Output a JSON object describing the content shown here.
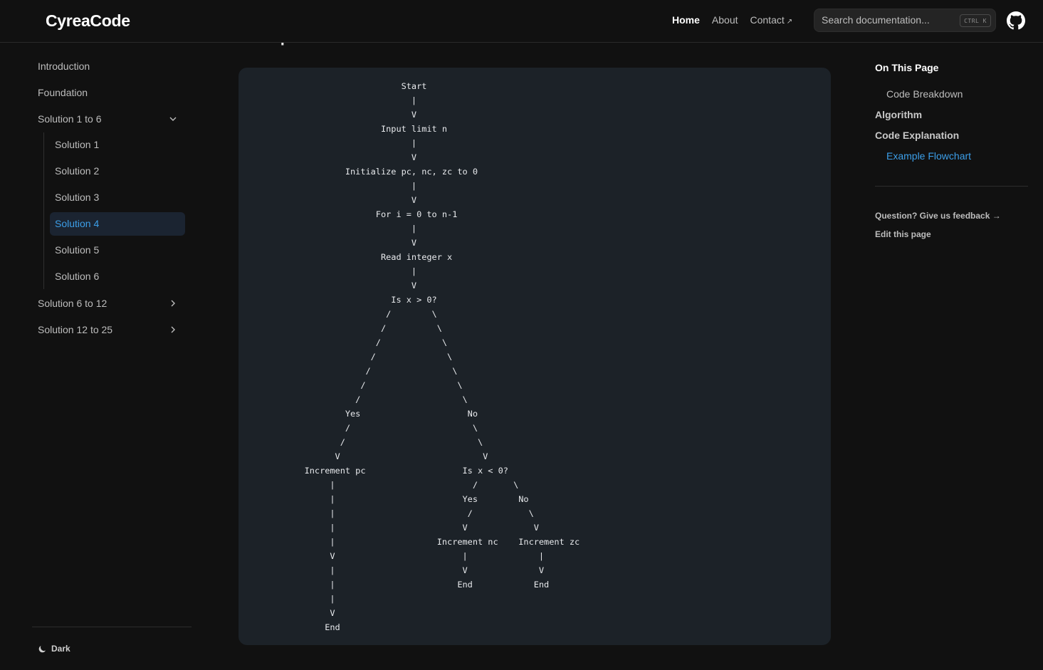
{
  "header": {
    "logo": "CyreaCode",
    "nav": [
      {
        "label": "Home",
        "active": true
      },
      {
        "label": "About",
        "active": false
      },
      {
        "label": "Contact",
        "active": false,
        "external": true
      }
    ],
    "search": {
      "placeholder": "Search documentation...",
      "shortcut": "CTRL K"
    },
    "github_icon": "github-icon"
  },
  "sidebar": {
    "items": [
      {
        "label": "Introduction"
      },
      {
        "label": "Foundation"
      },
      {
        "label": "Solution 1 to 6",
        "expanded": true
      },
      {
        "label": "Solution 6 to 12",
        "expanded": false
      },
      {
        "label": "Solution 12 to 25",
        "expanded": false
      }
    ],
    "subitems": [
      {
        "label": "Solution 1"
      },
      {
        "label": "Solution 2"
      },
      {
        "label": "Solution 3"
      },
      {
        "label": "Solution 4",
        "active": true
      },
      {
        "label": "Solution 5"
      },
      {
        "label": "Solution 6"
      }
    ],
    "theme_label": "Dark",
    "theme_icon": "moon-icon"
  },
  "main": {
    "section_heading": "Example Flowchart",
    "flowchart": "                             Start\n                               |\n                               V\n                         Input limit n\n                               |\n                               V\n                  Initialize pc, nc, zc to 0\n                               |\n                               V\n                        For i = 0 to n-1\n                               |\n                               V\n                         Read integer x\n                               |\n                               V\n                           Is x > 0?\n                          /        \\\n                         /          \\\n                        /            \\\n                       /              \\\n                      /                \\\n                     /                  \\\n                    /                    \\\n                  Yes                     No\n                  /                        \\\n                 /                          \\\n                V                            V\n          Increment pc                   Is x < 0?\n               |                           /       \\\n               |                         Yes        No\n               |                          /           \\\n               |                         V             V\n               |                    Increment nc    Increment zc\n               V                         |              |\n               |                         V              V\n               |                        End            End\n               |\n               V\n              End"
  },
  "toc": {
    "title": "On This Page",
    "items": [
      {
        "label": "Code Breakdown",
        "level": 2
      },
      {
        "label": "Algorithm",
        "level": 1
      },
      {
        "label": "Code Explanation",
        "level": 1
      },
      {
        "label": "Example Flowchart",
        "level": 2,
        "active": true
      }
    ],
    "feedback": "Question? Give us feedback →",
    "edit": "Edit this page"
  },
  "colors": {
    "accent": "#3c9ee8",
    "background": "#111111",
    "code_bg": "#1c2228"
  }
}
